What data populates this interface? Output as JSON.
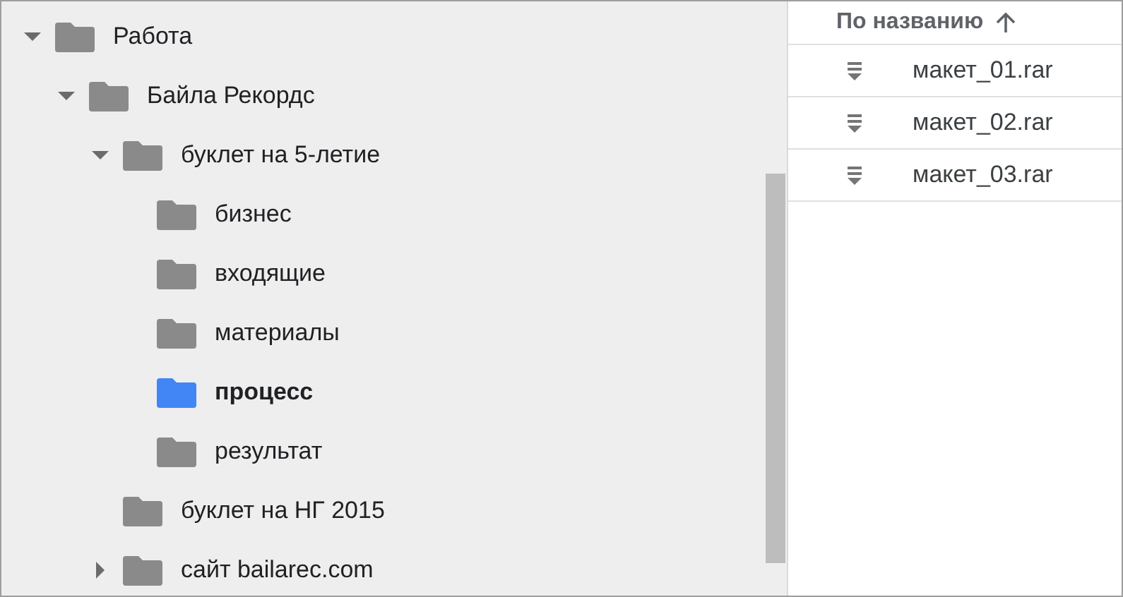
{
  "tree": [
    {
      "name": "Работа",
      "expanded": true,
      "selected": false,
      "children": [
        {
          "name": "Байла Рекордс",
          "expanded": true,
          "selected": false,
          "children": [
            {
              "name": "буклет на 5-летие",
              "expanded": true,
              "selected": false,
              "children": [
                {
                  "name": "бизнес",
                  "selected": false
                },
                {
                  "name": "входящие",
                  "selected": false
                },
                {
                  "name": "материалы",
                  "selected": false
                },
                {
                  "name": "процесс",
                  "selected": true
                },
                {
                  "name": "результат",
                  "selected": false
                }
              ]
            },
            {
              "name": "буклет на НГ 2015",
              "selected": false
            },
            {
              "name": "сайт bailarec.com",
              "expanded": false,
              "selected": false
            }
          ]
        }
      ]
    }
  ],
  "files": {
    "sort_label": "По названию",
    "sort_ascending": true,
    "rows": [
      {
        "name": "макет_01.rar"
      },
      {
        "name": "макет_02.rar"
      },
      {
        "name": "макет_03.rar"
      }
    ]
  }
}
